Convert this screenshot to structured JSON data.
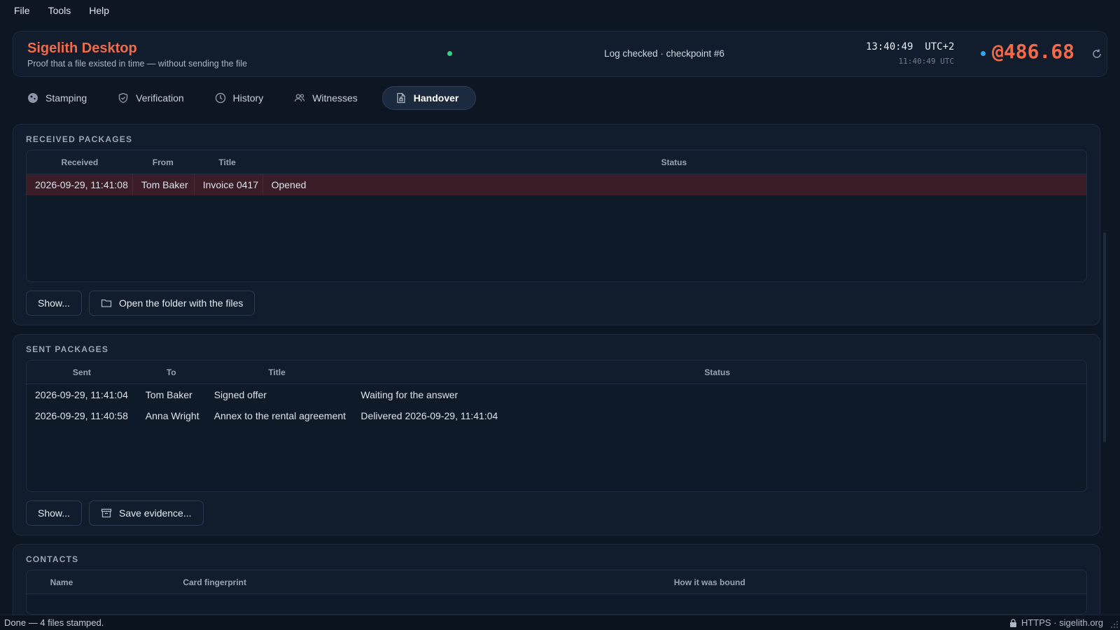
{
  "menu": {
    "file": "File",
    "tools": "Tools",
    "help": "Help"
  },
  "header": {
    "title": "Sigelith Desktop",
    "subtitle": "Proof that a file existed in time — without sending the file",
    "log_status": "Log checked · checkpoint #6",
    "clock_local": "13:40:49",
    "clock_zone": "UTC+2",
    "clock_utc": "11:40:49 UTC",
    "balance": "@486.68",
    "colors": {
      "accent": "#f26a48",
      "ok": "#35d07f",
      "info": "#36a6f0"
    }
  },
  "tabs": [
    {
      "label": "Stamping",
      "icon": "stamp-icon",
      "active": false
    },
    {
      "label": "Verification",
      "icon": "shield-check-icon",
      "active": false
    },
    {
      "label": "History",
      "icon": "clock-icon",
      "active": false
    },
    {
      "label": "Witnesses",
      "icon": "users-icon",
      "active": false
    },
    {
      "label": "Handover",
      "icon": "document-lock-icon",
      "active": true
    }
  ],
  "received": {
    "title": "RECEIVED PACKAGES",
    "columns": [
      "Received",
      "From",
      "Title",
      "Status"
    ],
    "rows": [
      {
        "received": "2026-09-29, 11:41:08",
        "from": "Tom Baker",
        "title": "Invoice 0417",
        "status": "Opened"
      }
    ],
    "show_label": "Show...",
    "folder_label": "Open the folder with the files"
  },
  "sent": {
    "title": "SENT PACKAGES",
    "columns": [
      "Sent",
      "To",
      "Title",
      "Status"
    ],
    "rows": [
      {
        "sent": "2026-09-29, 11:41:04",
        "to": "Tom Baker",
        "title": "Signed offer",
        "status": "Waiting for the answer"
      },
      {
        "sent": "2026-09-29, 11:40:58",
        "to": "Anna Wright",
        "title": "Annex to the rental agreement",
        "status": "Delivered 2026-09-29, 11:41:04"
      }
    ],
    "show_label": "Show...",
    "save_label": "Save evidence..."
  },
  "contacts": {
    "title": "CONTACTS",
    "columns": [
      "Name",
      "Card fingerprint",
      "How it was bound"
    ]
  },
  "statusbar": {
    "message": "Done — 4 files stamped.",
    "connection": "HTTPS · sigelith.org"
  }
}
